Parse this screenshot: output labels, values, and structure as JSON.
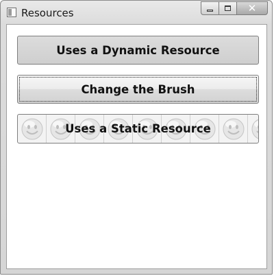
{
  "window": {
    "title": "Resources",
    "minimize_glyph": "minimize-icon",
    "maximize_glyph": "maximize-icon",
    "close_glyph": "✕"
  },
  "buttons": {
    "dynamic_label": "Uses a Dynamic Resource",
    "brush_label": "Change the Brush",
    "static_label": "Uses a Static Resource"
  },
  "icons": {
    "app": "window-app-icon",
    "tile": "smiley-face-icon"
  },
  "colors": {
    "client_background": "#ffffff",
    "button_text": "#111111"
  }
}
